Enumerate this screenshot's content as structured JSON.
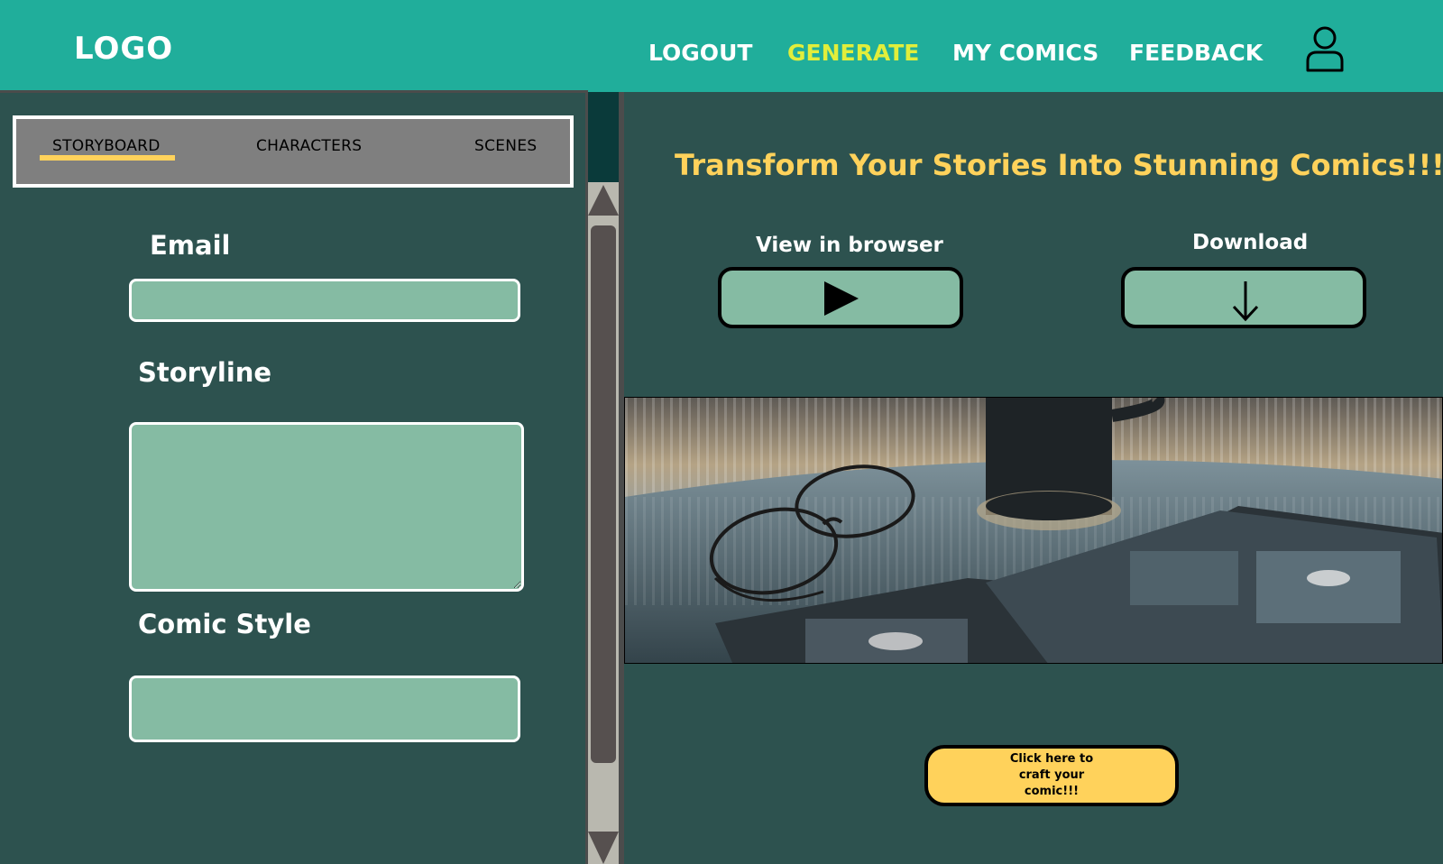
{
  "header": {
    "logo": "LOGO",
    "nav": {
      "logout": "LOGOUT",
      "generate": "GENERATE",
      "my_comics": "MY COMICS",
      "feedback": "FEEDBACK"
    },
    "active_nav": "generate",
    "user_icon": "user-icon"
  },
  "left_panel": {
    "tabs": {
      "storyboard": "STORYBOARD",
      "characters": "CHARACTERS",
      "scenes": "SCENES"
    },
    "active_tab": "storyboard",
    "form": {
      "email_label": "Email",
      "email_value": "",
      "storyline_label": "Storyline",
      "storyline_value": "",
      "comic_style_label": "Comic Style",
      "comic_style_value": ""
    }
  },
  "main": {
    "headline": "Transform Your Stories Into Stunning Comics!!!",
    "view_caption": "View in browser",
    "view_icon": "play-icon",
    "download_caption": "Download",
    "download_icon": "arrow-down-icon",
    "craft_button": "Click here to craft your comic!!!"
  },
  "colors": {
    "header_bg": "#20ae9b",
    "panel_bg": "#2d524f",
    "field_bg": "#85bba3",
    "accent_yellow": "#ffd25b",
    "nav_active": "#e1ee3b",
    "tab_bar_bg": "#7f7f7f"
  }
}
